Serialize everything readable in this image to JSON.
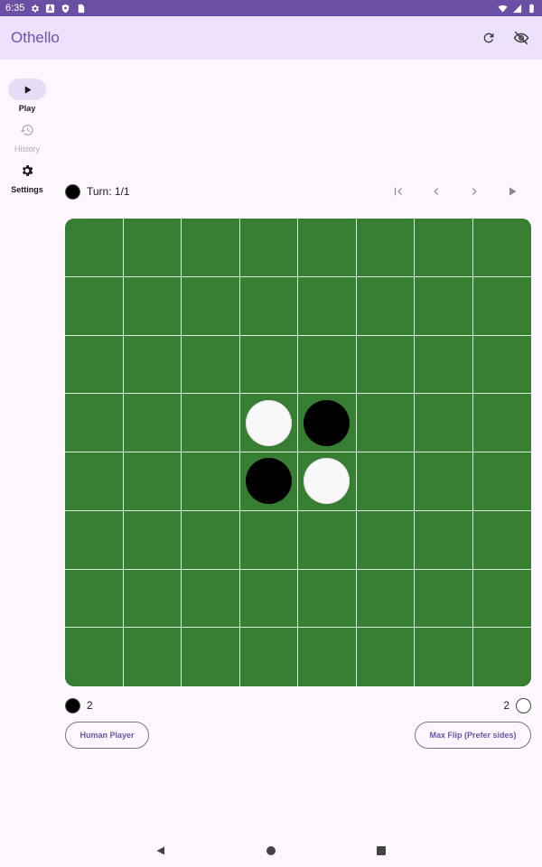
{
  "status_bar": {
    "time": "6:35",
    "left_icons": [
      "gear-icon",
      "a-icon",
      "shield-icon",
      "sim-card-icon"
    ],
    "right_icons": [
      "wifi-icon",
      "signal-icon",
      "battery-icon"
    ]
  },
  "app_bar": {
    "title": "Othello",
    "actions": [
      "refresh-icon",
      "eye-off-icon"
    ]
  },
  "rail": {
    "items": [
      {
        "label": "Play",
        "icon": "play-icon",
        "state": "selected"
      },
      {
        "label": "History",
        "icon": "history-icon",
        "state": "disabled"
      },
      {
        "label": "Settings",
        "icon": "gear-icon",
        "state": "enabled"
      }
    ]
  },
  "turn": {
    "current_player": "black",
    "text": "Turn: 1/1"
  },
  "history_nav": [
    "first-page-icon",
    "chevron-left-icon",
    "chevron-right-icon",
    "play-icon"
  ],
  "board": {
    "size": 8,
    "background": "#367e32",
    "rows": [
      [
        "",
        "",
        "",
        "",
        "",
        "",
        "",
        ""
      ],
      [
        "",
        "",
        "",
        "",
        "",
        "",
        "",
        ""
      ],
      [
        "",
        "",
        "",
        "",
        "",
        "",
        "",
        ""
      ],
      [
        "",
        "",
        "",
        "W",
        "B",
        "",
        "",
        ""
      ],
      [
        "",
        "",
        "",
        "B",
        "W",
        "",
        "",
        ""
      ],
      [
        "",
        "",
        "",
        "",
        "",
        "",
        "",
        ""
      ],
      [
        "",
        "",
        "",
        "",
        "",
        "",
        "",
        ""
      ],
      [
        "",
        "",
        "",
        "",
        "",
        "",
        "",
        ""
      ]
    ]
  },
  "score": {
    "black": "2",
    "white": "2"
  },
  "players": {
    "black_label": "Human Player",
    "white_label": "Max Flip (Prefer sides)"
  },
  "system_nav": [
    "back-icon",
    "home-icon",
    "recents-icon"
  ],
  "colors": {
    "status_bar": "#6b4fa5",
    "app_bar": "#ece0fb",
    "accent": "#6d54a8",
    "background": "#fdf6fe"
  }
}
